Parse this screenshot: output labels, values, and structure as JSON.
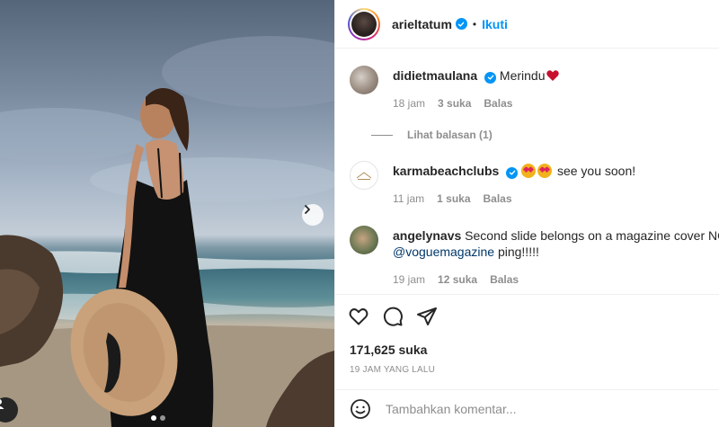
{
  "post": {
    "author": "arieltatum",
    "follow_label": "Ikuti",
    "separator": "•",
    "likes": "171,625 suka",
    "timestamp": "19 JAM YANG LALU",
    "comment_placeholder": "Tambahkan komentar...",
    "carousel": {
      "slide_count": 2,
      "active_slide": 1
    }
  },
  "comments": [
    {
      "user": "didietmaulana",
      "verified": true,
      "text": "Merindu",
      "emoji": "red-heart-icon",
      "time": "18 jam",
      "likes": "3 suka",
      "reply": "Balas",
      "view_replies": "Lihat balasan (1)"
    },
    {
      "user": "karmabeachclubs",
      "verified": true,
      "text": "see you soon!",
      "emoji": "heart-eyes-emoji-icon",
      "time": "11 jam",
      "likes": "1 suka",
      "reply": "Balas"
    },
    {
      "user": "angelynavs",
      "verified": false,
      "text_line1": "Second slide belongs on a magazine cover NOW!",
      "mention": "@voguemagazine",
      "text_line2": "ping!!!!!",
      "time": "19 jam",
      "likes": "12 suka",
      "reply": "Balas"
    }
  ],
  "colors": {
    "accent": "#0095f6",
    "text": "#262626",
    "muted": "#8e8e8e",
    "mention": "#00376b",
    "border": "#efefef"
  }
}
